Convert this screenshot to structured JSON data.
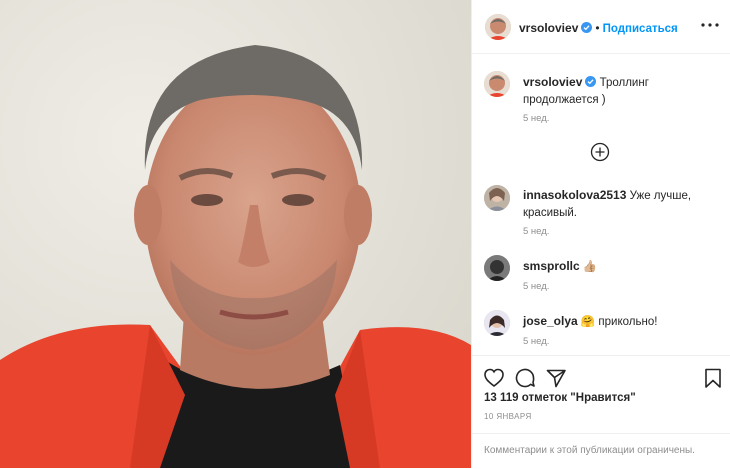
{
  "post": {
    "username": "vrsoloviev",
    "follow_label": "Подписаться",
    "dot": "•",
    "caption": "Троллинг продолжается )",
    "caption_time": "5 нед."
  },
  "comments": [
    {
      "username": "innasokolova2513",
      "text": "Уже лучше, красивый.",
      "time": "5 нед."
    },
    {
      "username": "smsprollc",
      "text": "👍🏼",
      "time": "5 нед."
    },
    {
      "username": "jose_olya",
      "text": "🤗 прикольно!",
      "time": "5 нед."
    }
  ],
  "footer": {
    "likes": "13 119 отметок \"Нравится\"",
    "date": "10 ЯНВАРЯ",
    "comments_limited": "Комментарии к этой публикации ограничены."
  },
  "colors": {
    "accent": "#0095f6",
    "verified": "#3897f0",
    "muted": "#8e8e8e",
    "sweater": "#e8442e"
  },
  "icons": [
    "more-options-icon",
    "verified-badge-icon",
    "plus-circle-icon",
    "heart-icon",
    "comment-icon",
    "share-icon",
    "bookmark-icon"
  ]
}
